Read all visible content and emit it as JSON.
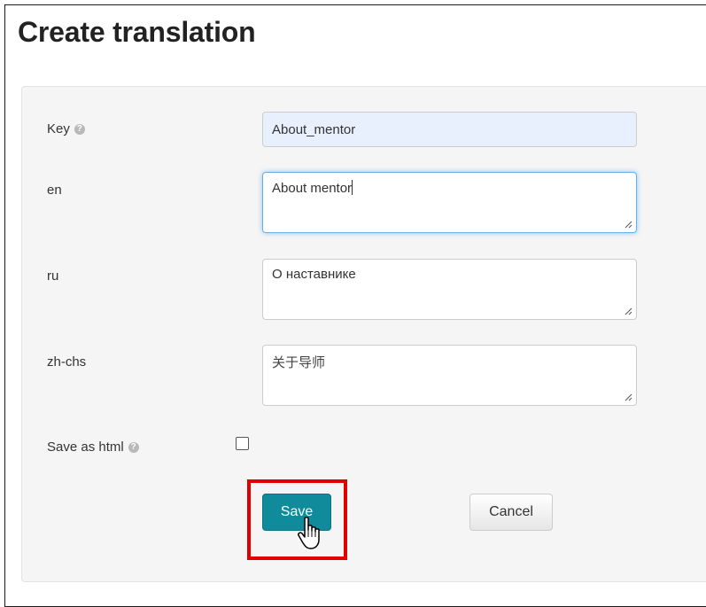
{
  "page": {
    "title": "Create translation"
  },
  "form": {
    "key": {
      "label": "Key",
      "value": "About_mentor"
    },
    "en": {
      "label": "en",
      "value": "About mentor"
    },
    "ru": {
      "label": "ru",
      "value": "О наставнике"
    },
    "zh": {
      "label": "zh-chs",
      "value": "关于导师"
    },
    "save_as_html": {
      "label": "Save as html",
      "checked": false
    },
    "help_icon": "?"
  },
  "buttons": {
    "save": "Save",
    "cancel": "Cancel"
  },
  "colors": {
    "save_button": "#0f8b9c",
    "highlight": "#e00000",
    "focus_glow": "#66afe9"
  }
}
